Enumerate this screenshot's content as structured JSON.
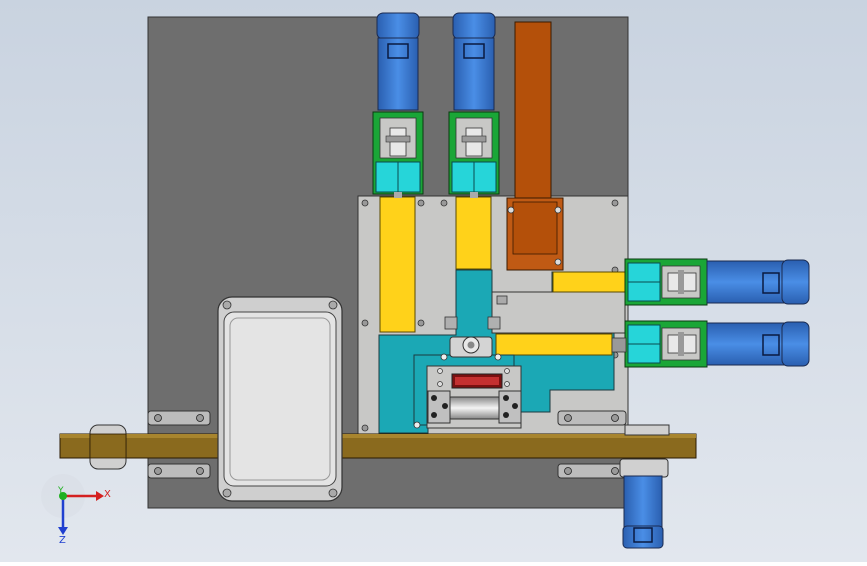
{
  "viewport": {
    "background_top": "#c9d3e0",
    "background_bottom": "#e2e7ee"
  },
  "colors": {
    "base_plate": "#6e6e6e",
    "mount_plate": "#c8c8c6",
    "teal_block": "#1ba8b5",
    "yellow_slide": "#ffd21a",
    "rust_column": "#b4500a",
    "motor_blue": "#3a7fd6",
    "coupling_green": "#1aa637",
    "cyan_coupler": "#26d5d9",
    "belt_brown": "#8a6a1e",
    "guard_gray": "#cfcfcf",
    "bracket_gray": "#bcbcbc",
    "dark_red": "#7a1010"
  },
  "parts": [
    {
      "name": "base-plate"
    },
    {
      "name": "mount-plate"
    },
    {
      "name": "vertical-motor-left"
    },
    {
      "name": "vertical-motor-right"
    },
    {
      "name": "horizontal-motor-upper"
    },
    {
      "name": "horizontal-motor-lower"
    },
    {
      "name": "bottom-motor"
    },
    {
      "name": "rust-column"
    },
    {
      "name": "conveyor-belt"
    },
    {
      "name": "guard-cover"
    }
  ],
  "axis_triad": {
    "x_label": "X",
    "y_label": "Y",
    "z_label": "Z",
    "x_color": "#d42020",
    "y_color": "#20b020",
    "z_color": "#2040d0"
  }
}
